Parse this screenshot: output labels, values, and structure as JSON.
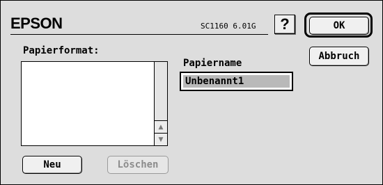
{
  "header": {
    "brand": "EPSON",
    "version": "SC1160 6.01G",
    "help_label": "?"
  },
  "buttons": {
    "ok": "OK",
    "cancel": "Abbruch",
    "new": "Neu",
    "delete": "Löschen"
  },
  "paper_format": {
    "label": "Papierformat:",
    "items": []
  },
  "paper_name": {
    "label": "Papiername",
    "value": "Unbenannt1"
  },
  "icons": {
    "scroll_up": "triangle-up",
    "scroll_down": "triangle-down"
  }
}
